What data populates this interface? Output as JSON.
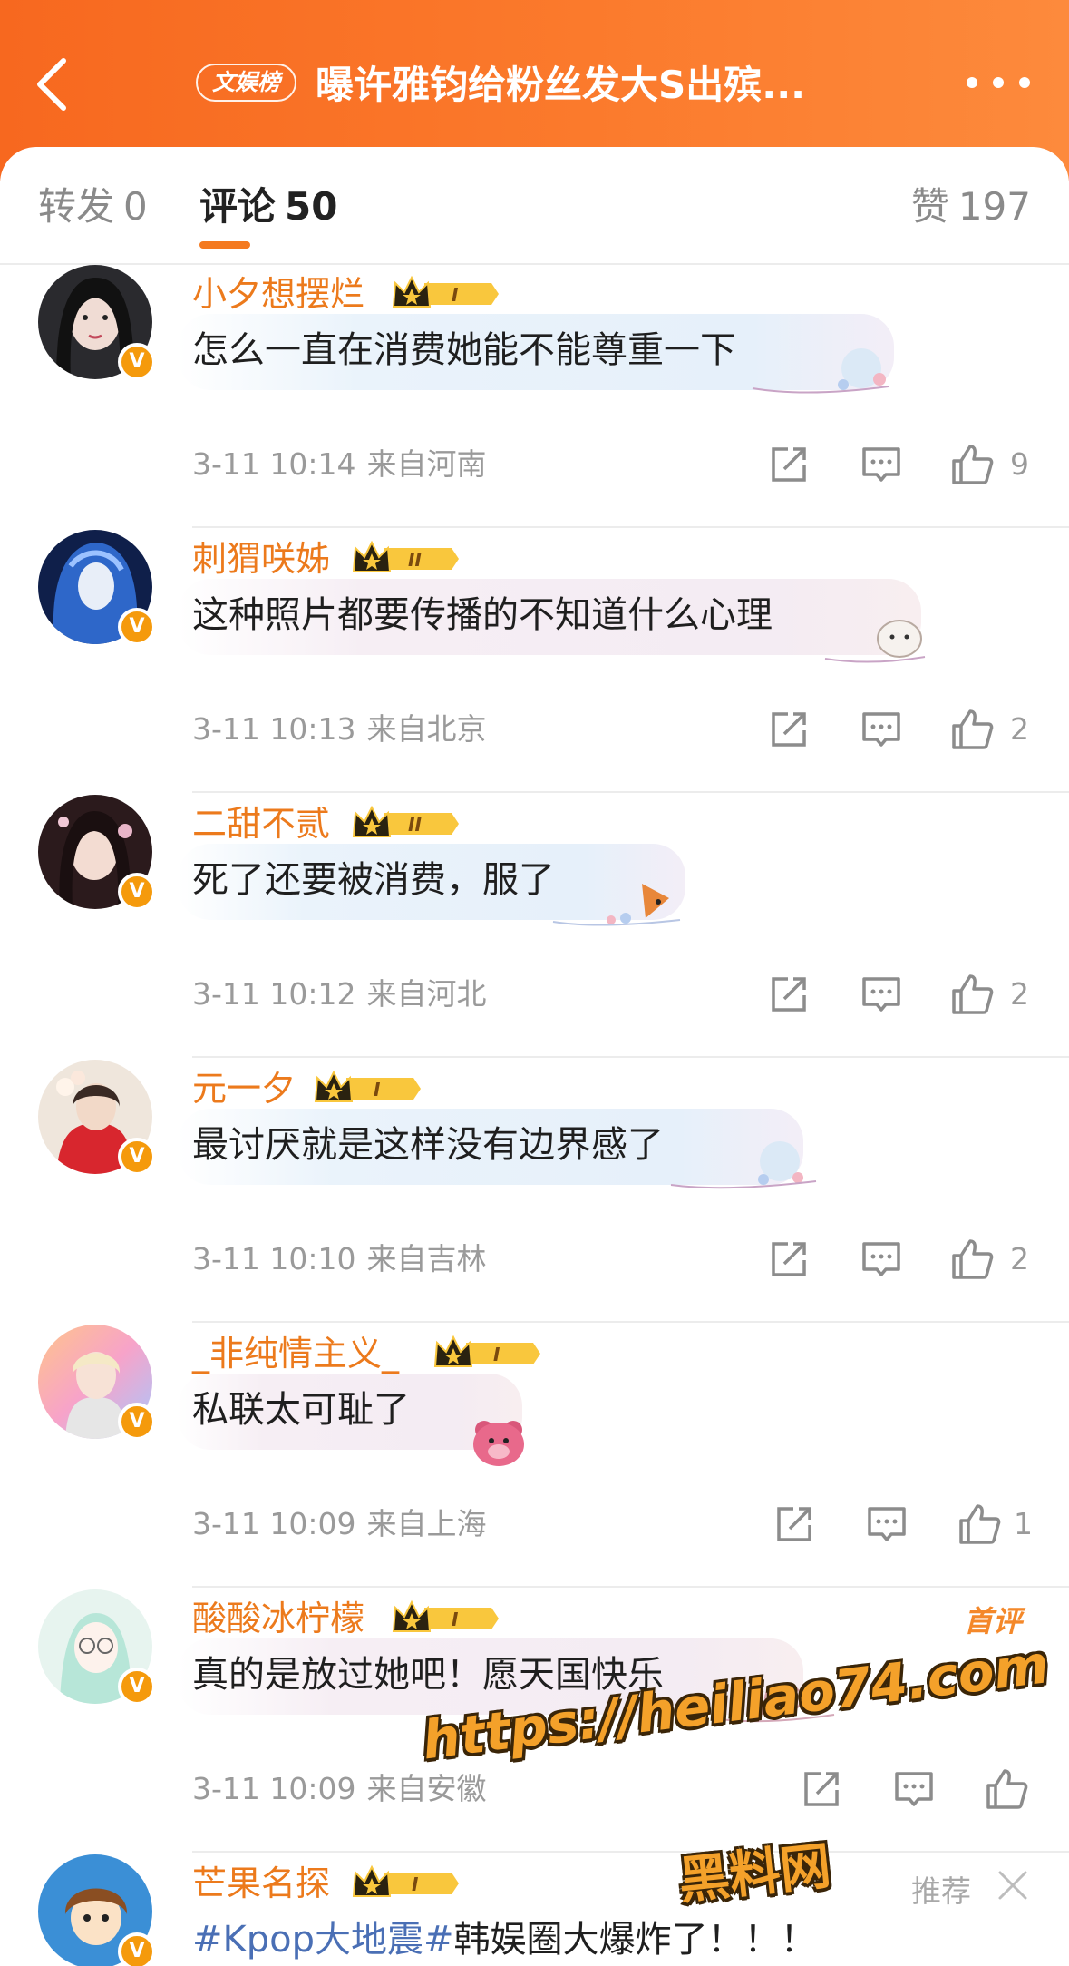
{
  "header": {
    "tag": "文娱榜",
    "title": "曝许雅钧给粉丝发大S出殡..."
  },
  "tabs": {
    "repost_label": "转发",
    "repost_count": "0",
    "comment_label": "评论",
    "comment_count": "50",
    "like_label": "赞",
    "like_count": "197"
  },
  "colors": {
    "header_start": "#f7681f",
    "header_end": "#fd8a3c",
    "username": "#ec7a1c",
    "accent": "#f47a20",
    "meta_gray": "#9a9a9a",
    "topic_link": "#4a6fb5"
  },
  "comments": [
    {
      "username": "小夕想摆烂",
      "level": "I",
      "text": "怎么一直在消费她能不能尊重一下",
      "time": "3-11 10:14",
      "location": "来自河南",
      "likes": "9"
    },
    {
      "username": "刺猬咲姊",
      "level": "II",
      "text": "这种照片都要传播的不知道什么心理",
      "time": "3-11 10:13",
      "location": "来自北京",
      "likes": "2"
    },
    {
      "username": "二甜不贰",
      "level": "II",
      "text": "死了还要被消费，服了",
      "time": "3-11 10:12",
      "location": "来自河北",
      "likes": "2"
    },
    {
      "username": "元一夕",
      "level": "I",
      "text": "最讨厌就是这样没有边界感了",
      "time": "3-11 10:10",
      "location": "来自吉林",
      "likes": "2"
    },
    {
      "username": "_非纯情主义_",
      "level": "I",
      "text": "私联太可耻了",
      "time": "3-11 10:09",
      "location": "来自上海",
      "likes": "1"
    },
    {
      "username": "酸酸冰柠檬",
      "level": "I",
      "text": "真的是放过她吧！愿天国快乐",
      "time": "3-11 10:09",
      "location": "来自安徽",
      "likes": "",
      "badge": "首评"
    },
    {
      "username": "芒果名探",
      "level": "I",
      "topic": "#Kpop大地震#",
      "text": "韩娱圈大爆炸了！！！",
      "tag": "推荐"
    }
  ],
  "watermark": {
    "url": "https://heiliao74.com",
    "name": "黑料网"
  },
  "icons": [
    "back-arrow-icon",
    "more-dots-icon",
    "crown-icon",
    "verified-v-icon",
    "share-icon",
    "reply-icon",
    "thumbs-up-icon",
    "close-icon"
  ]
}
